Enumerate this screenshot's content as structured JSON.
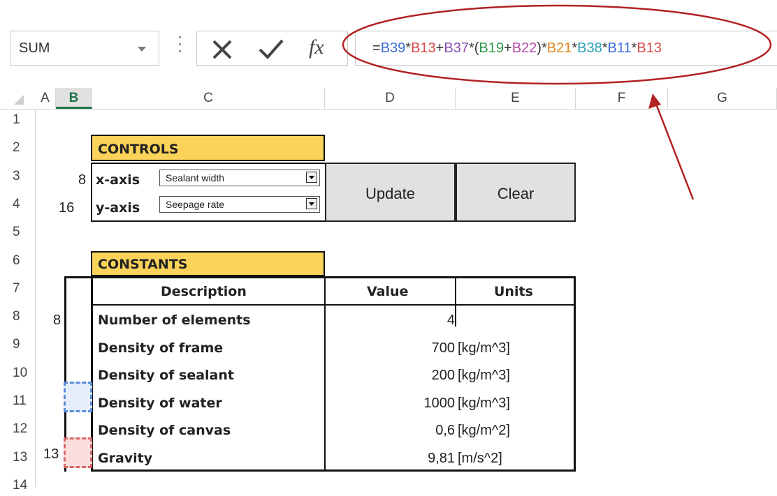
{
  "formula_bar": {
    "name_box": "SUM",
    "fx_label": "fx",
    "formula_parts": [
      {
        "t": "=",
        "c": "#333"
      },
      {
        "t": "B39",
        "c": "#3b6fd6"
      },
      {
        "t": "*",
        "c": "#333"
      },
      {
        "t": "B13",
        "c": "#d64a4a"
      },
      {
        "t": "+",
        "c": "#333"
      },
      {
        "t": "B37",
        "c": "#8a4fb3"
      },
      {
        "t": "*(",
        "c": "#333"
      },
      {
        "t": "B19",
        "c": "#2e9a48"
      },
      {
        "t": "+",
        "c": "#333"
      },
      {
        "t": "B22",
        "c": "#b54aa6"
      },
      {
        "t": ")*",
        "c": "#333"
      },
      {
        "t": "B21",
        "c": "#e08a1e"
      },
      {
        "t": "*",
        "c": "#333"
      },
      {
        "t": "B38",
        "c": "#2aa1b5"
      },
      {
        "t": "*",
        "c": "#333"
      },
      {
        "t": "B11",
        "c": "#3b6fd6"
      },
      {
        "t": "*",
        "c": "#333"
      },
      {
        "t": "B13",
        "c": "#d64a4a"
      }
    ]
  },
  "columns": [
    "A",
    "B",
    "C",
    "D",
    "E",
    "F",
    "G"
  ],
  "rows": [
    "1",
    "2",
    "3",
    "4",
    "5",
    "6",
    "7",
    "8",
    "9",
    "10",
    "11",
    "12",
    "13",
    "14"
  ],
  "controls": {
    "title": "CONTROLS",
    "x_axis_index": "8",
    "x_axis_label": "x-axis",
    "x_axis_value": "Sealant width",
    "y_axis_index": "16",
    "y_axis_label": "y-axis",
    "y_axis_value": "Seepage rate",
    "update_label": "Update",
    "clear_label": "Clear"
  },
  "constants": {
    "title": "CONSTANTS",
    "headers": [
      "Description",
      "Value",
      "Units"
    ],
    "a8": "8",
    "a13": "13",
    "items": [
      {
        "desc": "Number of elements",
        "value": "4",
        "units": ""
      },
      {
        "desc": "Density of frame",
        "value": "700",
        "units": "[kg/m^3]"
      },
      {
        "desc": "Density of sealant",
        "value": "200",
        "units": "[kg/m^3]"
      },
      {
        "desc": "Density of water",
        "value": "1000",
        "units": "[kg/m^3]"
      },
      {
        "desc": "Density of canvas",
        "value": "0,6",
        "units": "[kg/m^2]"
      },
      {
        "desc": "Gravity",
        "value": "9,81",
        "units": "[m/s^2]"
      }
    ]
  },
  "colors": {
    "header_fill": "#fcd35a",
    "ellipse": "#b22222",
    "arrow": "#b22222",
    "selected_col_header": "#217346"
  }
}
